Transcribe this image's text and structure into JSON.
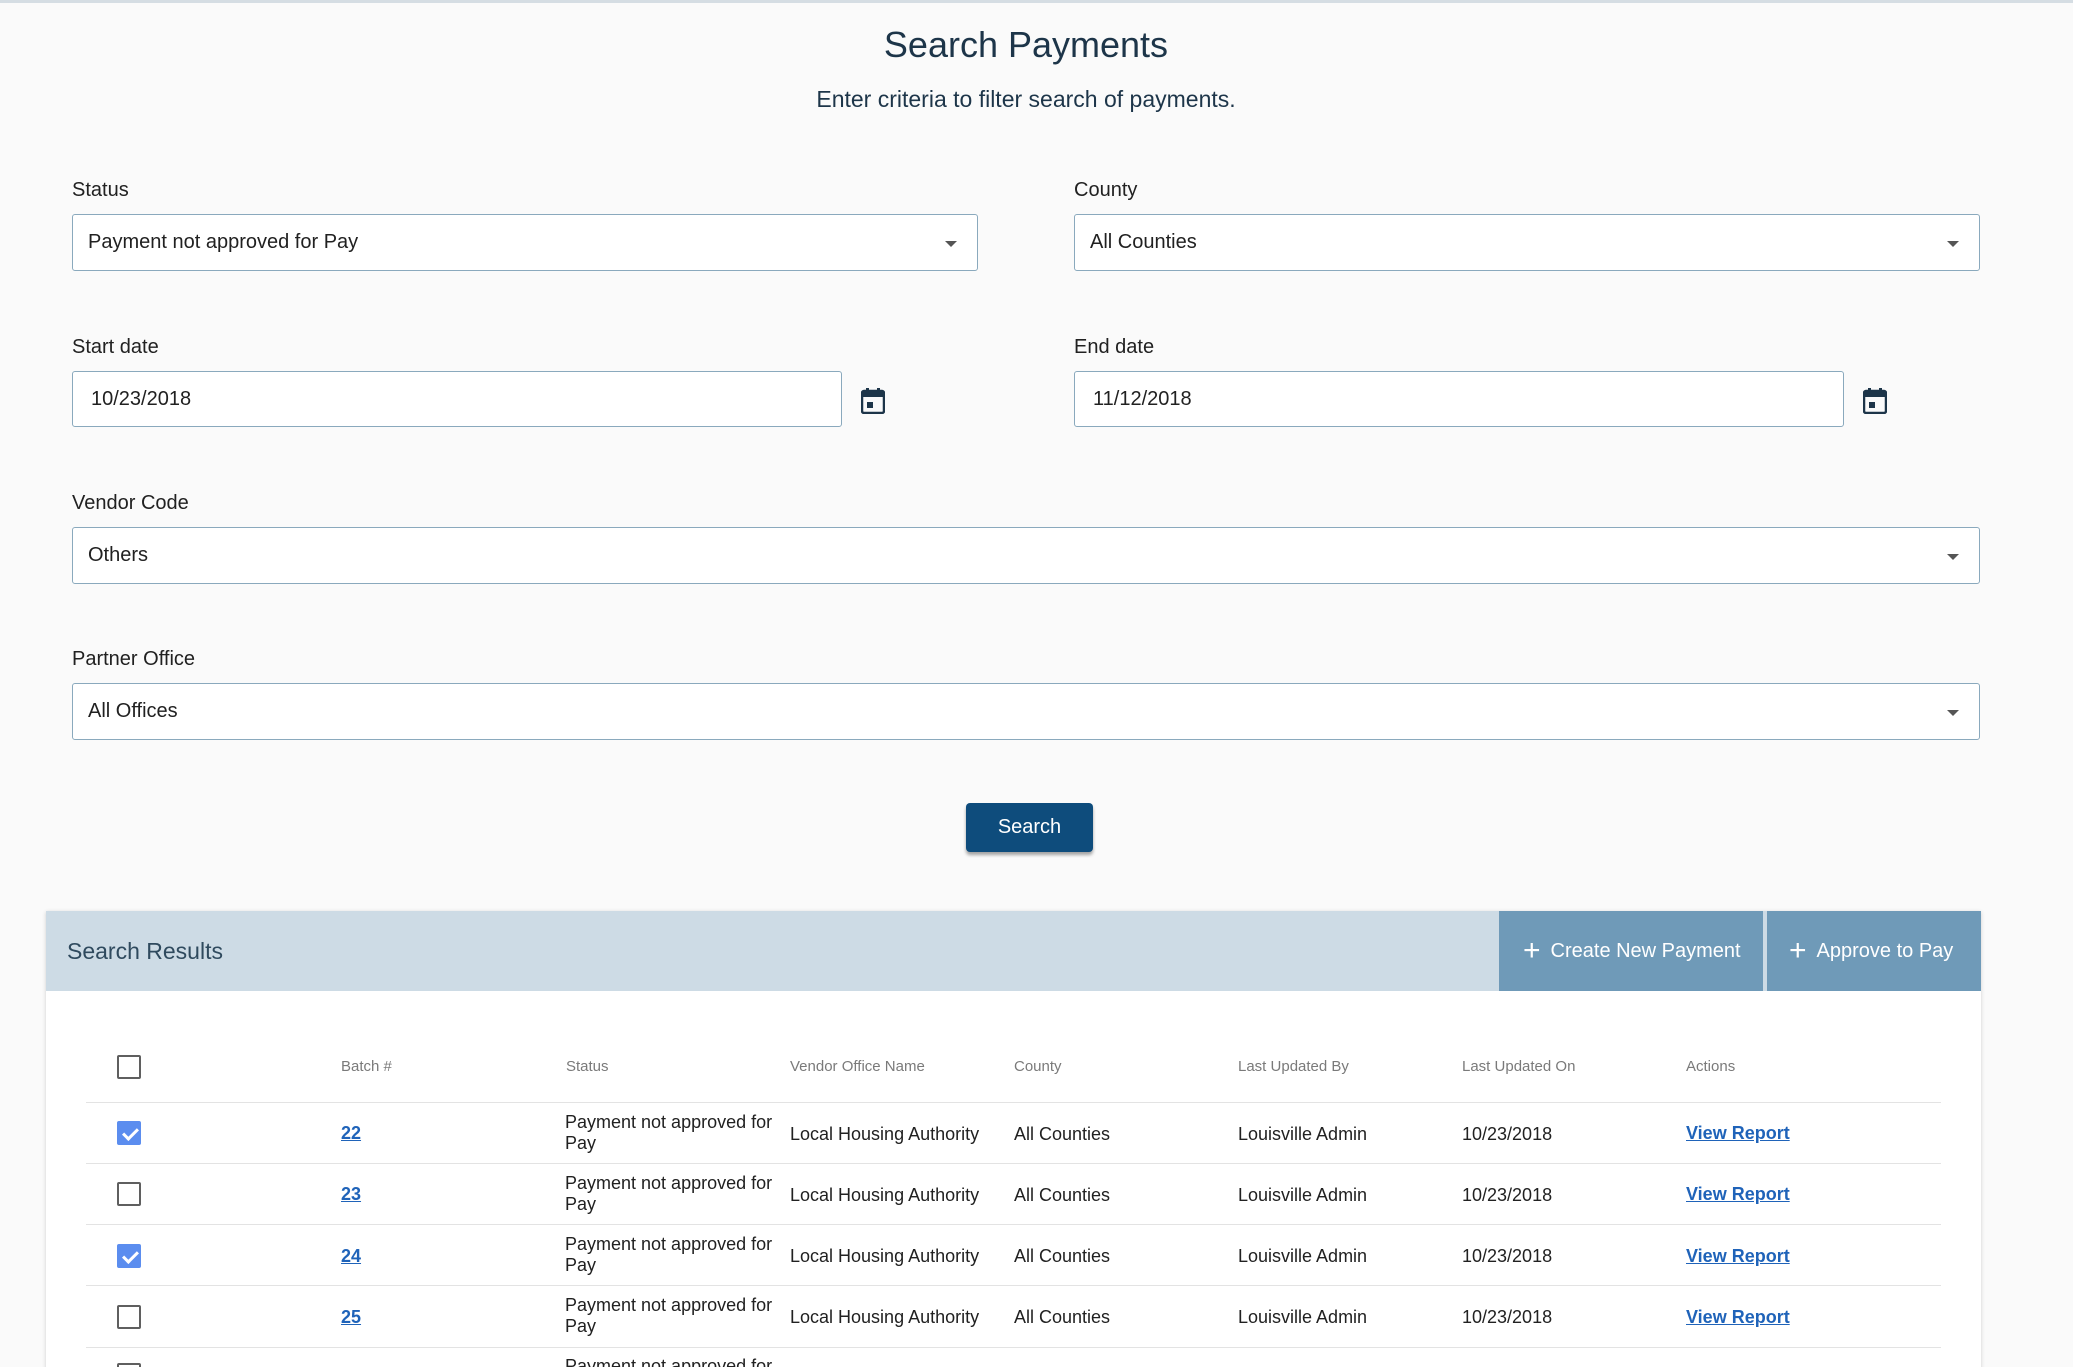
{
  "header": {
    "title": "Search Payments",
    "subtitle": "Enter criteria to filter search of payments."
  },
  "filters": {
    "status": {
      "label": "Status",
      "value": "Payment not approved for Pay"
    },
    "county": {
      "label": "County",
      "value": "All Counties"
    },
    "start_date": {
      "label": "Start date",
      "value": "10/23/2018"
    },
    "end_date": {
      "label": "End date",
      "value": "11/12/2018"
    },
    "vendor_code": {
      "label": "Vendor Code",
      "value": "Others"
    },
    "partner_office": {
      "label": "Partner Office",
      "value": "All Offices"
    }
  },
  "search_button": "Search",
  "results": {
    "title": "Search Results",
    "create_button": "Create New Payment",
    "approve_button": "Approve to Pay",
    "columns": [
      "Batch #",
      "Status",
      "Vendor Office Name",
      "County",
      "Last Updated By",
      "Last Updated On",
      "Actions"
    ],
    "rows": [
      {
        "checked": true,
        "batch": "22",
        "status": "Payment not approved for Pay",
        "vendor": "Local Housing Authority",
        "county": "All Counties",
        "updated_by": "Louisville Admin",
        "updated_on": "10/23/2018",
        "action": "View Report"
      },
      {
        "checked": false,
        "batch": "23",
        "status": "Payment not approved for Pay",
        "vendor": "Local Housing Authority",
        "county": "All Counties",
        "updated_by": "Louisville Admin",
        "updated_on": "10/23/2018",
        "action": "View Report"
      },
      {
        "checked": true,
        "batch": "24",
        "status": "Payment not approved for Pay",
        "vendor": "Local Housing Authority",
        "county": "All Counties",
        "updated_by": "Louisville Admin",
        "updated_on": "10/23/2018",
        "action": "View Report"
      },
      {
        "checked": false,
        "batch": "25",
        "status": "Payment not approved for Pay",
        "vendor": "Local Housing Authority",
        "county": "All Counties",
        "updated_by": "Louisville Admin",
        "updated_on": "10/23/2018",
        "action": "View Report"
      },
      {
        "checked": false,
        "batch": "",
        "status": "Payment not approved for Pay",
        "vendor": "",
        "county": "",
        "updated_by": "",
        "updated_on": "",
        "action": ""
      }
    ]
  },
  "colors": {
    "primary_button": "#0e4c7c",
    "header_button": "#6f9ab8",
    "panel_header": "#cddbe5",
    "checkbox_checked": "#5b8def",
    "link": "#1f63b9"
  }
}
